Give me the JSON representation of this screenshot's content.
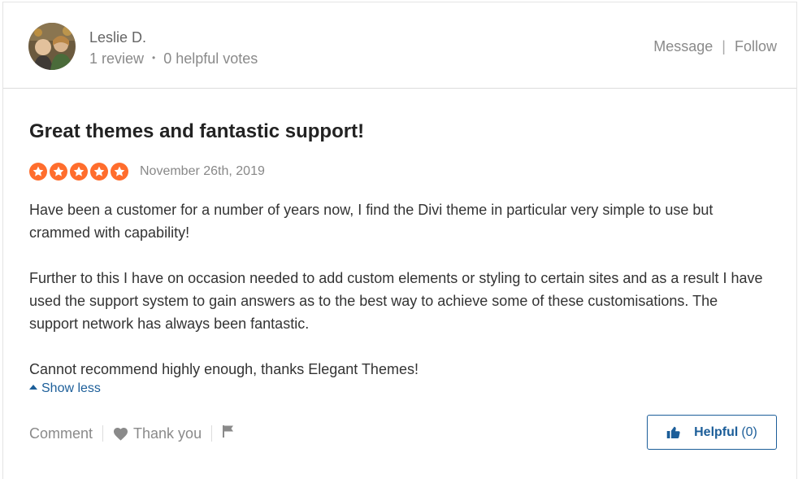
{
  "reviewer": {
    "name": "Leslie D.",
    "review_count": "1 review",
    "separator": "•",
    "helpful_votes": "0 helpful votes"
  },
  "header_actions": {
    "message": "Message",
    "separator": "|",
    "follow": "Follow"
  },
  "review": {
    "title": "Great themes and fantastic support!",
    "rating": 5,
    "rating_max": 5,
    "star_color": "#ff6d2d",
    "date": "November 26th, 2019",
    "paragraphs": [
      "Have been a customer for a number of years now, I find the Divi theme in particular very simple to use but crammed with capability!",
      "Further to this I have on occasion needed to add custom elements or styling to certain sites and as a result I have used the support system to gain answers as to the best way to achieve some of these customisations. The support network has always been fantastic.",
      "Cannot recommend highly enough, thanks Elegant Themes!"
    ],
    "show_less": "Show less"
  },
  "footer": {
    "comment": "Comment",
    "thank_you": "Thank you",
    "helpful_label": "Helpful",
    "helpful_count": "(0)"
  },
  "colors": {
    "accent": "#1c5e99",
    "star": "#ff6d2d",
    "muted_text": "#8a8a8a"
  },
  "icons": {
    "avatar": "avatar",
    "star": "star-icon",
    "caret": "caret-up-icon",
    "heart": "heart-icon",
    "flag": "flag-icon",
    "thumb": "thumbs-up-icon"
  }
}
